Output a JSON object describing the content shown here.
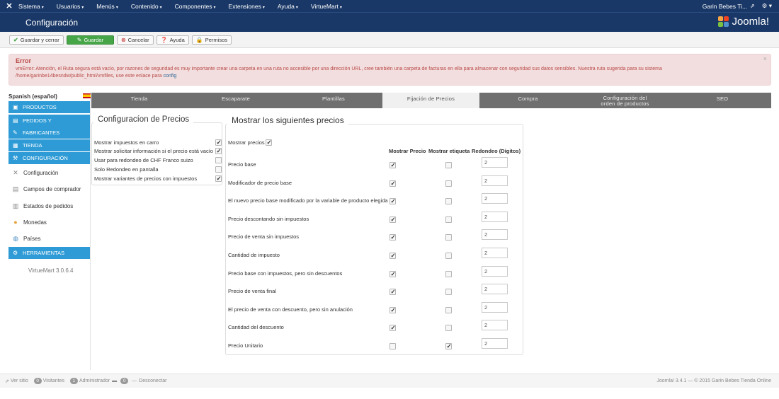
{
  "topbar": {
    "menu": [
      "Sistema",
      "Usuarios",
      "Menús",
      "Contenido",
      "Componentes",
      "Extensiones",
      "Ayuda",
      "VirtueMart"
    ],
    "user": "Garin Bebes Ti..."
  },
  "header": {
    "title": "Configuración",
    "logo_text": "Joomla!"
  },
  "toolbar": {
    "save_close": "Guardar y cerrar",
    "save": "Guardar",
    "cancel": "Cancelar",
    "help": "Ayuda",
    "permissions": "Permisos"
  },
  "alert": {
    "heading": "Error",
    "message": "vmError: Atención, el Ruta segura está vacío, por razones de seguridad es muy importante crear una carpeta en una ruta no accesible por una dirección URL, cree también una carpeta de facturas en ella para almacenar con seguridad sus datos sensibles. Nuestra ruta sugerida para su sistema /home/garinbe14besndw/public_html/vmfiles, use este enlace para",
    "link": "config",
    "close": "×"
  },
  "sidebar": {
    "language": "Spanish (español)",
    "sections": [
      {
        "label": "PRODUCTOS"
      },
      {
        "label": "PEDIDOS Y"
      },
      {
        "label": "FABRICANTES"
      },
      {
        "label": "TIENDA"
      },
      {
        "label": "CONFIGURACIÓN"
      }
    ],
    "sub_items": [
      {
        "label": "Configuración"
      },
      {
        "label": "Campos de comprador"
      },
      {
        "label": "Estados de pedidos"
      },
      {
        "label": "Monedas"
      },
      {
        "label": "Países"
      }
    ],
    "tools": "HERRAMIENTAS",
    "version": "VirtueMart 3.0.6.4"
  },
  "tabs": [
    {
      "label": "Tienda"
    },
    {
      "label": "Escaparate"
    },
    {
      "label": "Plantillas"
    },
    {
      "label": "Fijación de Precios"
    },
    {
      "label": "Compra"
    },
    {
      "label": "Configuración del orden de productos"
    },
    {
      "label": "SEO"
    }
  ],
  "price_config": {
    "legend": "Configuracíon de Precios",
    "options": [
      {
        "label": "Mostrar impuestos en carro",
        "checked": true
      },
      {
        "label": "Mostrar solicitar información si el precio está vacío",
        "checked": true
      },
      {
        "label": "Usar para redondeo de CHF Franco suizo",
        "checked": false
      },
      {
        "label": "Solo Redondeo en pantalla",
        "checked": false
      },
      {
        "label": "Mostrar variantes de precios con impuestos",
        "checked": true
      }
    ]
  },
  "show_prices": {
    "legend": "Mostrar los siguientes precios",
    "show_label": "Mostrar precios",
    "show_checked": true,
    "col_show": "Mostrar Precio",
    "col_label": "Mostrar etiqueta",
    "col_round": "Redondeo (Dígitos)",
    "rows": [
      {
        "label": "Precio base",
        "show": true,
        "tag": false,
        "round": "2"
      },
      {
        "label": "Modificador de precio base",
        "show": true,
        "tag": false,
        "round": "2"
      },
      {
        "label": "El nuevo precio base modificado por la variable de producto elegida",
        "show": true,
        "tag": false,
        "round": "2"
      },
      {
        "label": "Precio descontando sin impuestos",
        "show": true,
        "tag": false,
        "round": "2"
      },
      {
        "label": "Precio de venta sin impuestos",
        "show": true,
        "tag": false,
        "round": "2"
      },
      {
        "label": "Cantidad de impuesto",
        "show": true,
        "tag": false,
        "round": "2"
      },
      {
        "label": "Precio base con impuestos, pero sin descuentos",
        "show": true,
        "tag": false,
        "round": "2"
      },
      {
        "label": "Precio de venta final",
        "show": true,
        "tag": false,
        "round": "2"
      },
      {
        "label": "El precio de venta con descuento, pero sin anulación",
        "show": true,
        "tag": false,
        "round": "2"
      },
      {
        "label": "Cantidad del descuento",
        "show": true,
        "tag": false,
        "round": "2"
      },
      {
        "label": "Precio Unitario",
        "show": false,
        "tag": true,
        "round": "2"
      }
    ]
  },
  "footer": {
    "view_site": "Ver sitio",
    "visitors_count": "0",
    "visitors": "Visitantes",
    "admin_count": "1",
    "admin": "Administrador",
    "messages_count": "0",
    "logout": "Desconectar",
    "copyright": "Joomla! 3.4.1 — © 2015 Garin Bebes Tienda Online"
  }
}
